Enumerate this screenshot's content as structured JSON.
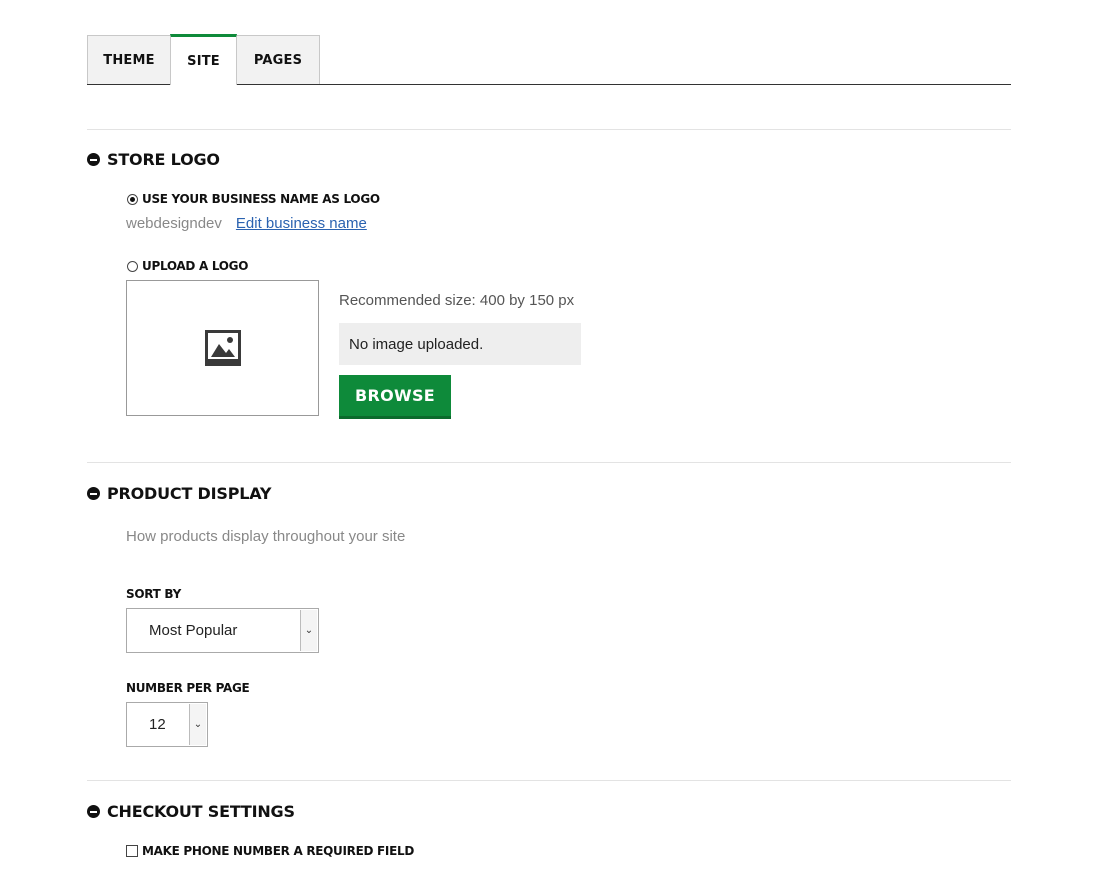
{
  "tabs": [
    {
      "label": "THEME",
      "active": false
    },
    {
      "label": "SITE",
      "active": true
    },
    {
      "label": "PAGES",
      "active": false
    }
  ],
  "colors": {
    "accent": "#0e8a3a",
    "link": "#2a62b0"
  },
  "store_logo": {
    "title": "STORE LOGO",
    "use_business_name_label": "USE YOUR BUSINESS NAME AS LOGO",
    "use_business_name_selected": true,
    "business_name": "webdesigndev",
    "edit_link": "Edit business name",
    "upload_label": "UPLOAD A LOGO",
    "upload_selected": false,
    "recommended": "Recommended size: 400 by 150 px",
    "no_image": "No image uploaded.",
    "browse": "BROWSE",
    "placeholder_icon": "image-placeholder-icon"
  },
  "product_display": {
    "title": "PRODUCT DISPLAY",
    "description": "How products display throughout your site",
    "sort_by_label": "SORT BY",
    "sort_by_value": "Most Popular",
    "per_page_label": "NUMBER PER PAGE",
    "per_page_value": "12"
  },
  "checkout": {
    "title": "CHECKOUT SETTINGS",
    "phone_required_label": "MAKE PHONE NUMBER A REQUIRED FIELD",
    "phone_required_checked": false
  }
}
